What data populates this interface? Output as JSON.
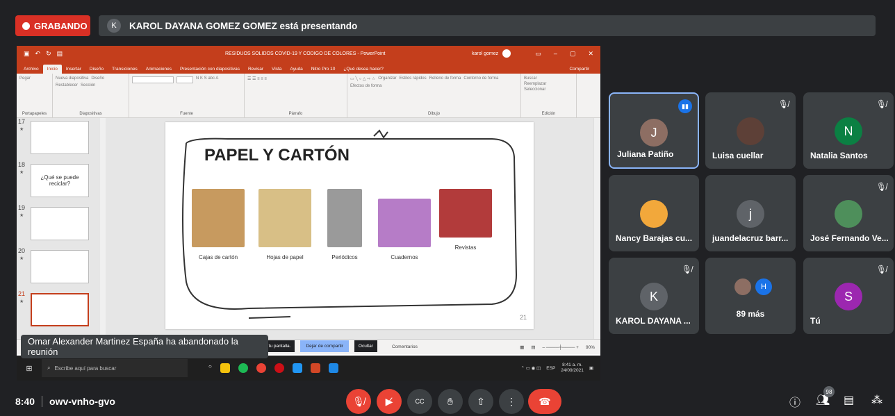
{
  "top": {
    "recording_label": "GRABANDO",
    "presenter_initial": "K",
    "presenting_text": "KAROL DAYANA GOMEZ GOMEZ está presentando"
  },
  "ppt": {
    "doc_title": "RESIDUOS SOLIDOS COVID-19 Y CODIGO DE COLORES - PowerPoint",
    "user_name": "karol gomez",
    "tabs": [
      "Archivo",
      "Inicio",
      "Insertar",
      "Diseño",
      "Transiciones",
      "Animaciones",
      "Presentación con diapositivas",
      "Revisar",
      "Vista",
      "Ayuda",
      "Nitro Pro 10",
      "¿Qué desea hacer?"
    ],
    "share_label": "Compartir",
    "ribbon": {
      "portapapeles": "Portapapeles",
      "diapositivas": "Diapositivas",
      "fuente": "Fuente",
      "parrafo": "Párrafo",
      "dibujo": "Dibujo",
      "edicion": "Edición",
      "pegar": "Pegar",
      "nueva": "Nueva diapositiva",
      "diseno": "Diseño",
      "restablecer": "Restablecer",
      "seccion": "Sección",
      "organizar": "Organizar",
      "estilos": "Estilos rápidos",
      "relleno": "Relleno de forma",
      "contorno": "Contorno de forma",
      "efectos": "Efectos de forma",
      "buscar": "Buscar",
      "reemplazar": "Reemplazar",
      "seleccionar": "Seleccionar"
    },
    "thumbnails": [
      {
        "num": "17",
        "text": ""
      },
      {
        "num": "18",
        "text": "¿Qué se puede reciclar?"
      },
      {
        "num": "19",
        "text": ""
      },
      {
        "num": "20",
        "text": ""
      },
      {
        "num": "21",
        "text": ""
      }
    ],
    "slide": {
      "title": "PAPEL Y CARTÓN",
      "items": [
        {
          "caption": "Cajas de cartón",
          "color": "#c79a5f"
        },
        {
          "caption": "Hojas de papel",
          "color": "#d8bf86"
        },
        {
          "caption": "Periódicos",
          "color": "#9a9a9a"
        },
        {
          "caption": "Cuadernos",
          "color": "#b67cc7"
        },
        {
          "caption": "Revistas",
          "color": "#b23b3b"
        }
      ],
      "page_number": "21"
    },
    "statusbar": {
      "comments": "Comentarios",
      "zoom": "90%"
    },
    "share_bar": {
      "text": "Compartiendo tu pantalla.",
      "stop": "Dejar de compartir",
      "hide": "Ocultar"
    },
    "taskbar": {
      "search_placeholder": "Escribe aquí para buscar",
      "lang": "ESP",
      "time": "8:41 a. m.",
      "date": "24/09/2021"
    }
  },
  "toast": "Omar Alexander Martinez España ha abandonado la reunión",
  "participants": [
    {
      "name": "Juliana Patiño",
      "initial": "J",
      "color": "#8d6e63",
      "muted": false,
      "speaking": true
    },
    {
      "name": "Luisa cuellar",
      "initial": "",
      "color": "#5d4037",
      "muted": true,
      "speaking": false
    },
    {
      "name": "Natalia Santos",
      "initial": "N",
      "color": "#0b8043",
      "muted": true,
      "speaking": false
    },
    {
      "name": "Nancy Barajas cu...",
      "initial": "",
      "color": "#f2a83b",
      "muted": false,
      "speaking": false
    },
    {
      "name": "juandelacruz barr...",
      "initial": "j",
      "color": "#5f6368",
      "muted": false,
      "speaking": false
    },
    {
      "name": "José Fernando Ve...",
      "initial": "",
      "color": "#4e8f5b",
      "muted": true,
      "speaking": false
    },
    {
      "name": "KAROL DAYANA ...",
      "initial": "K",
      "color": "#5f6368",
      "muted": true,
      "speaking": false
    },
    {
      "name": "89 más",
      "initial": "H",
      "color": "#1a73e8",
      "muted": false,
      "speaking": false
    },
    {
      "name": "Tú",
      "initial": "S",
      "color": "#9c27b0",
      "muted": true,
      "speaking": false
    }
  ],
  "bottom": {
    "time": "8:40",
    "meeting_code": "owv-vnho-gvo",
    "participant_count": "98"
  }
}
